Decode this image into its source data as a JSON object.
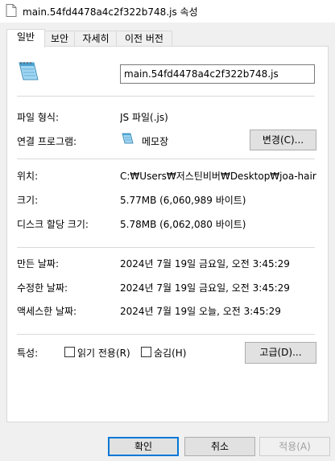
{
  "window": {
    "title": "main.54fd4478a4c2f322b748.js 속성"
  },
  "tabs": [
    {
      "label": "일반",
      "active": true
    },
    {
      "label": "보안",
      "active": false
    },
    {
      "label": "자세히",
      "active": false
    },
    {
      "label": "이전 버전",
      "active": false
    }
  ],
  "general": {
    "filename": "main.54fd4478a4c2f322b748.js",
    "file_type_label": "파일 형식:",
    "file_type_value": "JS 파일(.js)",
    "opens_with_label": "연결 프로그램:",
    "opens_with_value": "메모장",
    "change_button": "변경(C)...",
    "location_label": "위치:",
    "location_value": "C:₩Users₩저스틴비버₩Desktop₩joa-hair₩dis",
    "size_label": "크기:",
    "size_value": "5.77MB (6,060,989 바이트)",
    "disk_size_label": "디스크 할당 크기:",
    "disk_size_value": "5.78MB (6,062,080 바이트)",
    "created_label": "만든 날짜:",
    "created_value": "2024년 7월 19일 금요일, 오전 3:45:29",
    "modified_label": "수정한 날짜:",
    "modified_value": "2024년 7월 19일 금요일, 오전 3:45:29",
    "accessed_label": "액세스한 날짜:",
    "accessed_value": "2024년 7월 19일 오늘, 오전 3:45:29",
    "attributes_label": "특성:",
    "readonly_label": "읽기 전용(R)",
    "readonly_checked": false,
    "hidden_label": "숨김(H)",
    "hidden_checked": false,
    "advanced_button": "고급(D)..."
  },
  "footer": {
    "ok_button": "확인",
    "cancel_button": "취소",
    "apply_button": "적용(A)"
  }
}
